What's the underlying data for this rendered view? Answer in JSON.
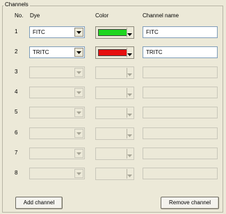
{
  "group": {
    "title": "Channels"
  },
  "headers": {
    "no": "No.",
    "dye": "Dye",
    "color": "Color",
    "channel_name": "Channel name"
  },
  "rows": [
    {
      "no": "1",
      "dye": "FITC",
      "color": "#1fd61f",
      "channel_name": "FITC",
      "enabled": true
    },
    {
      "no": "2",
      "dye": "TRITC",
      "color": "#e60f0f",
      "channel_name": "TRITC",
      "enabled": true
    },
    {
      "no": "3",
      "dye": "",
      "color": "",
      "channel_name": "",
      "enabled": false
    },
    {
      "no": "4",
      "dye": "",
      "color": "",
      "channel_name": "",
      "enabled": false
    },
    {
      "no": "5",
      "dye": "",
      "color": "",
      "channel_name": "",
      "enabled": false
    },
    {
      "no": "6",
      "dye": "",
      "color": "",
      "channel_name": "",
      "enabled": false
    },
    {
      "no": "7",
      "dye": "",
      "color": "",
      "channel_name": "",
      "enabled": false
    },
    {
      "no": "8",
      "dye": "",
      "color": "",
      "channel_name": "",
      "enabled": false
    }
  ],
  "buttons": {
    "add": "Add channel",
    "remove": "Remove channel"
  }
}
